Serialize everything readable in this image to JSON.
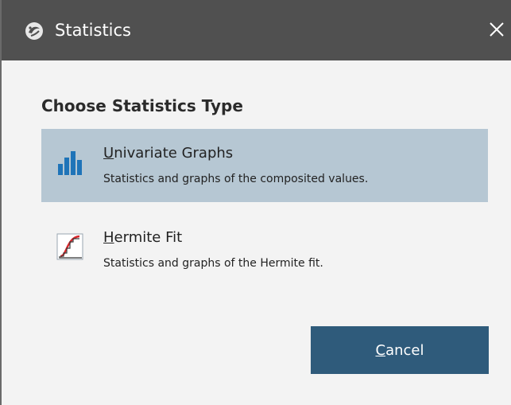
{
  "window": {
    "title": "Statistics",
    "icon": "app-logo-icon",
    "close_icon": "close-icon"
  },
  "heading": "Choose Statistics Type",
  "options": [
    {
      "mnemonic": "U",
      "title_rest": "nivariate Graphs",
      "description": "Statistics and graphs of the composited values.",
      "icon": "bar-chart-icon",
      "selected": true
    },
    {
      "mnemonic": "H",
      "title_rest": "ermite Fit",
      "description": "Statistics and graphs of the Hermite fit.",
      "icon": "hermite-curve-icon",
      "selected": false
    }
  ],
  "buttons": {
    "cancel_mnemonic": "C",
    "cancel_rest": "ancel"
  },
  "colors": {
    "titlebar": "#505050",
    "selected_option": "#b6c7d3",
    "button": "#2f5b7b",
    "background": "#f3f3f3"
  }
}
